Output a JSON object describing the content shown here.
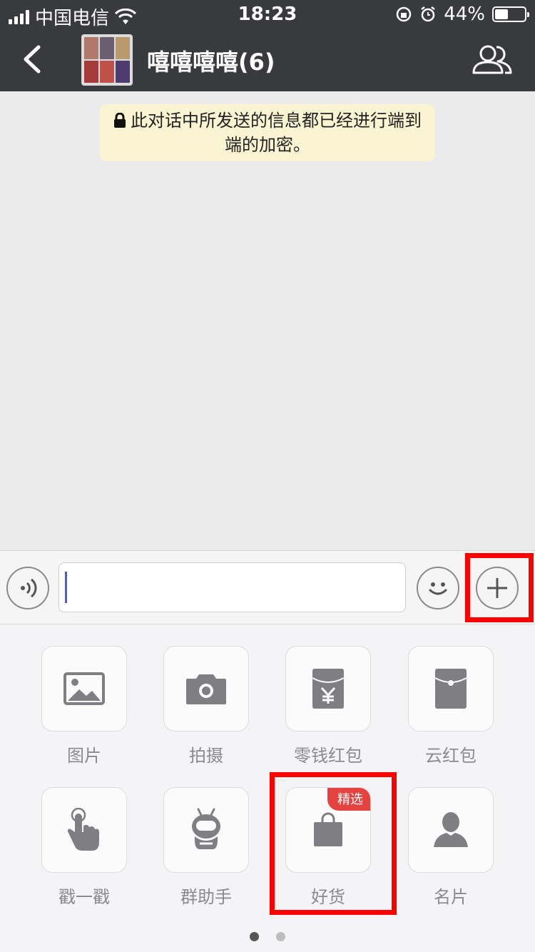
{
  "status_bar": {
    "carrier": "中国电信",
    "time": "18:23",
    "battery_percent": "44%",
    "battery_level": 0.44
  },
  "nav": {
    "title": "嘻嘻嘻嘻(6)",
    "back_icon": "chevron-left-icon",
    "members_icon": "group-members-icon"
  },
  "chat": {
    "encryption_notice": "此对话中所发送的信息都已经进行端到端的加密。"
  },
  "input_bar": {
    "voice_icon": "voice-icon",
    "emoji_icon": "emoji-icon",
    "more_icon": "plus-icon",
    "text_value": ""
  },
  "panel": {
    "items": [
      {
        "label": "图片",
        "icon": "image-icon"
      },
      {
        "label": "拍摄",
        "icon": "camera-icon"
      },
      {
        "label": "零钱红包",
        "icon": "red-packet-yuan-icon"
      },
      {
        "label": "云红包",
        "icon": "red-packet-icon"
      },
      {
        "label": "戳一戳",
        "icon": "tap-hand-icon"
      },
      {
        "label": "群助手",
        "icon": "robot-icon"
      },
      {
        "label": "好货",
        "icon": "shopping-bag-icon",
        "badge": "精选"
      },
      {
        "label": "名片",
        "icon": "contact-card-icon"
      }
    ],
    "page_count": 2,
    "current_page": 1
  },
  "colors": {
    "nav_bg": "#393a3e",
    "chat_bg": "#ebebeb",
    "notice_bg": "#faf4d2",
    "highlight": "#ff0000",
    "badge": "#e64340",
    "icon_gray": "#7f7f83"
  }
}
